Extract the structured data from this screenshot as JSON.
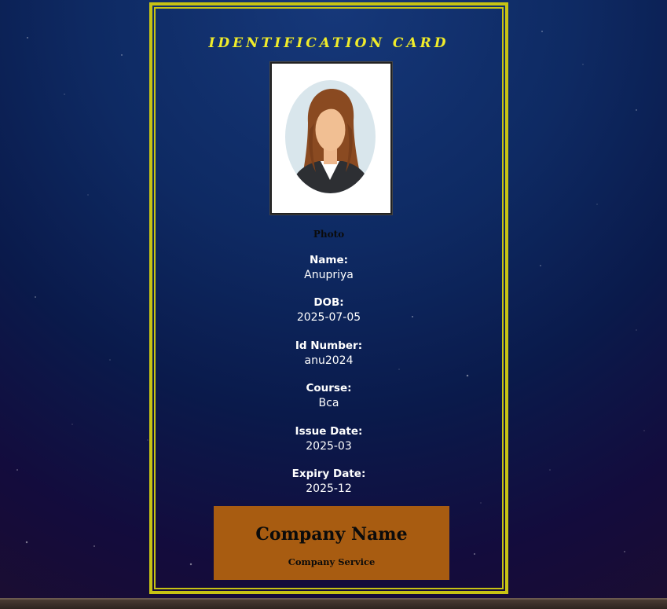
{
  "card": {
    "title": "IDENTIFICATION CARD",
    "photo_caption": "Photo",
    "fields": [
      {
        "label": "Name:",
        "value": "Anupriya"
      },
      {
        "label": "DOB:",
        "value": "2025-07-05"
      },
      {
        "label": "Id Number:",
        "value": "anu2024"
      },
      {
        "label": "Course:",
        "value": "Bca"
      },
      {
        "label": "Issue Date:",
        "value": "2025-03"
      },
      {
        "label": "Expiry Date:",
        "value": "2025-12"
      }
    ],
    "company": {
      "name": "Company Name",
      "service": "Company Service"
    }
  },
  "colors": {
    "card_border": "#c7c314",
    "title": "#f0ec2a",
    "company_box": "#a85c11",
    "field_text": "#ffffff"
  },
  "icons": {
    "photo": "female-avatar-icon"
  }
}
